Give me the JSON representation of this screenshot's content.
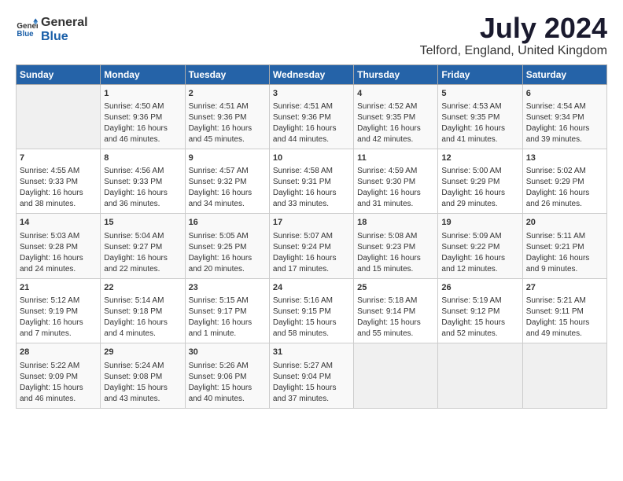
{
  "header": {
    "logo_general": "General",
    "logo_blue": "Blue",
    "month_year": "July 2024",
    "location": "Telford, England, United Kingdom"
  },
  "days_of_week": [
    "Sunday",
    "Monday",
    "Tuesday",
    "Wednesday",
    "Thursday",
    "Friday",
    "Saturday"
  ],
  "weeks": [
    [
      {
        "day": "",
        "content": ""
      },
      {
        "day": "1",
        "content": "Sunrise: 4:50 AM\nSunset: 9:36 PM\nDaylight: 16 hours\nand 46 minutes."
      },
      {
        "day": "2",
        "content": "Sunrise: 4:51 AM\nSunset: 9:36 PM\nDaylight: 16 hours\nand 45 minutes."
      },
      {
        "day": "3",
        "content": "Sunrise: 4:51 AM\nSunset: 9:36 PM\nDaylight: 16 hours\nand 44 minutes."
      },
      {
        "day": "4",
        "content": "Sunrise: 4:52 AM\nSunset: 9:35 PM\nDaylight: 16 hours\nand 42 minutes."
      },
      {
        "day": "5",
        "content": "Sunrise: 4:53 AM\nSunset: 9:35 PM\nDaylight: 16 hours\nand 41 minutes."
      },
      {
        "day": "6",
        "content": "Sunrise: 4:54 AM\nSunset: 9:34 PM\nDaylight: 16 hours\nand 39 minutes."
      }
    ],
    [
      {
        "day": "7",
        "content": "Sunrise: 4:55 AM\nSunset: 9:33 PM\nDaylight: 16 hours\nand 38 minutes."
      },
      {
        "day": "8",
        "content": "Sunrise: 4:56 AM\nSunset: 9:33 PM\nDaylight: 16 hours\nand 36 minutes."
      },
      {
        "day": "9",
        "content": "Sunrise: 4:57 AM\nSunset: 9:32 PM\nDaylight: 16 hours\nand 34 minutes."
      },
      {
        "day": "10",
        "content": "Sunrise: 4:58 AM\nSunset: 9:31 PM\nDaylight: 16 hours\nand 33 minutes."
      },
      {
        "day": "11",
        "content": "Sunrise: 4:59 AM\nSunset: 9:30 PM\nDaylight: 16 hours\nand 31 minutes."
      },
      {
        "day": "12",
        "content": "Sunrise: 5:00 AM\nSunset: 9:29 PM\nDaylight: 16 hours\nand 29 minutes."
      },
      {
        "day": "13",
        "content": "Sunrise: 5:02 AM\nSunset: 9:29 PM\nDaylight: 16 hours\nand 26 minutes."
      }
    ],
    [
      {
        "day": "14",
        "content": "Sunrise: 5:03 AM\nSunset: 9:28 PM\nDaylight: 16 hours\nand 24 minutes."
      },
      {
        "day": "15",
        "content": "Sunrise: 5:04 AM\nSunset: 9:27 PM\nDaylight: 16 hours\nand 22 minutes."
      },
      {
        "day": "16",
        "content": "Sunrise: 5:05 AM\nSunset: 9:25 PM\nDaylight: 16 hours\nand 20 minutes."
      },
      {
        "day": "17",
        "content": "Sunrise: 5:07 AM\nSunset: 9:24 PM\nDaylight: 16 hours\nand 17 minutes."
      },
      {
        "day": "18",
        "content": "Sunrise: 5:08 AM\nSunset: 9:23 PM\nDaylight: 16 hours\nand 15 minutes."
      },
      {
        "day": "19",
        "content": "Sunrise: 5:09 AM\nSunset: 9:22 PM\nDaylight: 16 hours\nand 12 minutes."
      },
      {
        "day": "20",
        "content": "Sunrise: 5:11 AM\nSunset: 9:21 PM\nDaylight: 16 hours\nand 9 minutes."
      }
    ],
    [
      {
        "day": "21",
        "content": "Sunrise: 5:12 AM\nSunset: 9:19 PM\nDaylight: 16 hours\nand 7 minutes."
      },
      {
        "day": "22",
        "content": "Sunrise: 5:14 AM\nSunset: 9:18 PM\nDaylight: 16 hours\nand 4 minutes."
      },
      {
        "day": "23",
        "content": "Sunrise: 5:15 AM\nSunset: 9:17 PM\nDaylight: 16 hours\nand 1 minute."
      },
      {
        "day": "24",
        "content": "Sunrise: 5:16 AM\nSunset: 9:15 PM\nDaylight: 15 hours\nand 58 minutes."
      },
      {
        "day": "25",
        "content": "Sunrise: 5:18 AM\nSunset: 9:14 PM\nDaylight: 15 hours\nand 55 minutes."
      },
      {
        "day": "26",
        "content": "Sunrise: 5:19 AM\nSunset: 9:12 PM\nDaylight: 15 hours\nand 52 minutes."
      },
      {
        "day": "27",
        "content": "Sunrise: 5:21 AM\nSunset: 9:11 PM\nDaylight: 15 hours\nand 49 minutes."
      }
    ],
    [
      {
        "day": "28",
        "content": "Sunrise: 5:22 AM\nSunset: 9:09 PM\nDaylight: 15 hours\nand 46 minutes."
      },
      {
        "day": "29",
        "content": "Sunrise: 5:24 AM\nSunset: 9:08 PM\nDaylight: 15 hours\nand 43 minutes."
      },
      {
        "day": "30",
        "content": "Sunrise: 5:26 AM\nSunset: 9:06 PM\nDaylight: 15 hours\nand 40 minutes."
      },
      {
        "day": "31",
        "content": "Sunrise: 5:27 AM\nSunset: 9:04 PM\nDaylight: 15 hours\nand 37 minutes."
      },
      {
        "day": "",
        "content": ""
      },
      {
        "day": "",
        "content": ""
      },
      {
        "day": "",
        "content": ""
      }
    ]
  ]
}
